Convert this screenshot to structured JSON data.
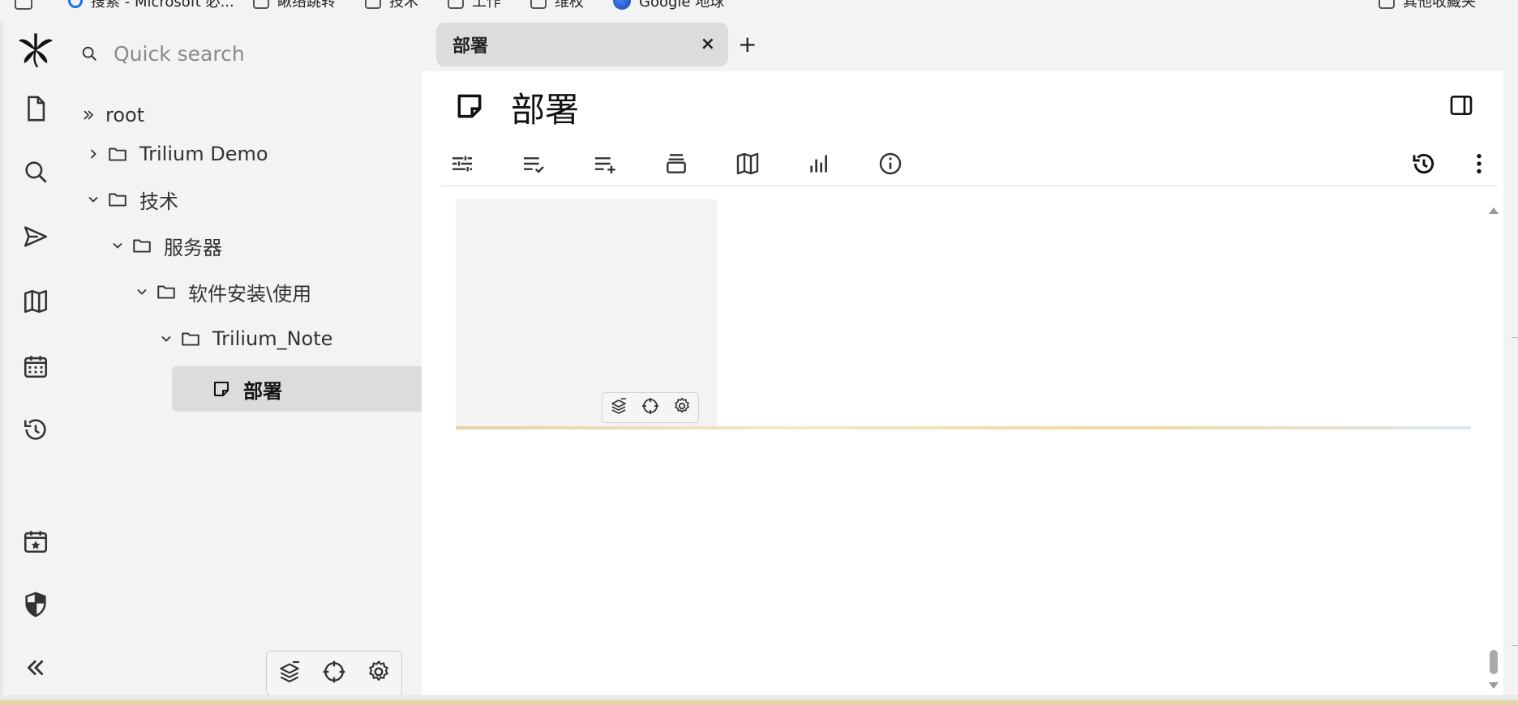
{
  "bookmarks": {
    "items": [
      {
        "label": "搜索 - Microsoft 必...",
        "icon": "search-icon"
      },
      {
        "label": "瞅络跳转",
        "icon": "folder-icon"
      },
      {
        "label": "技术",
        "icon": "folder-icon"
      },
      {
        "label": "工作",
        "icon": "folder-icon"
      },
      {
        "label": "维权",
        "icon": "folder-icon"
      },
      {
        "label": "Google 地球",
        "icon": "google-earth-icon"
      }
    ],
    "other": {
      "label": "其他收藏夹",
      "icon": "folder-icon"
    }
  },
  "launcher": {
    "items": [
      {
        "name": "app-logo",
        "icon": "trilium-logo-icon"
      },
      {
        "name": "new-note",
        "icon": "file-icon"
      },
      {
        "name": "search",
        "icon": "search-icon"
      },
      {
        "name": "jump-to",
        "icon": "send-icon"
      },
      {
        "name": "note-map",
        "icon": "map-icon"
      },
      {
        "name": "calendar",
        "icon": "calendar-icon"
      },
      {
        "name": "recent-changes",
        "icon": "history-icon"
      },
      {
        "name": "today",
        "icon": "calendar-star-icon"
      },
      {
        "name": "protected-session",
        "icon": "shield-icon"
      },
      {
        "name": "collapse",
        "icon": "double-chevron-left-icon"
      }
    ]
  },
  "tree": {
    "search_placeholder": "Quick search",
    "nodes": [
      {
        "label": "root",
        "level": 0,
        "state": "root"
      },
      {
        "label": "Trilium Demo",
        "level": 1,
        "state": "collapsed"
      },
      {
        "label": "技术",
        "level": 1,
        "state": "expanded"
      },
      {
        "label": "服务器",
        "level": 2,
        "state": "expanded"
      },
      {
        "label": "软件安装\\使用",
        "level": 3,
        "state": "expanded"
      },
      {
        "label": "Trilium_Note",
        "level": 4,
        "state": "expanded"
      },
      {
        "label": "部署",
        "level": 5,
        "state": "active"
      }
    ],
    "toolbar": [
      "collapse-tree-icon",
      "scroll-to-active-icon",
      "gear-icon"
    ]
  },
  "tabs": [
    {
      "title": "部署",
      "close": "×"
    }
  ],
  "new_tab_label": "+",
  "note": {
    "title": "部署",
    "icon": "note-icon"
  },
  "ribbon": {
    "left": [
      "options-icon",
      "todo-list-icon",
      "add-list-icon",
      "inbox-icon",
      "map-icon",
      "bar-chart-icon",
      "info-icon"
    ],
    "right": [
      "history-icon",
      "more-vertical-icon"
    ]
  },
  "canvas_toolbar": [
    "collapse-tree-icon",
    "scroll-to-active-icon",
    "gear-icon"
  ],
  "colors": {
    "app_bg": "#f3f3f3",
    "active_bg": "#dcdcdc",
    "content_bg": "#ffffff",
    "progress_accent": "#e7d3a6"
  }
}
